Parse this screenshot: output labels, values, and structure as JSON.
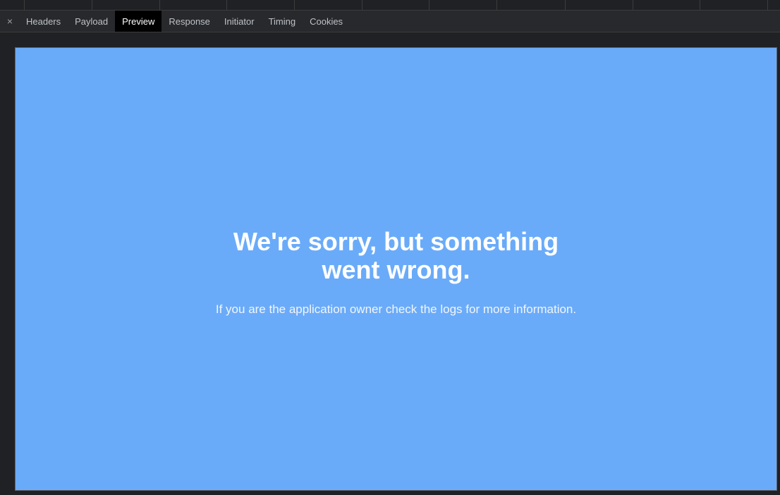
{
  "tabbar": {
    "close_icon": "close-icon",
    "close_glyph": "×",
    "tabs": [
      {
        "label": "Headers"
      },
      {
        "label": "Payload"
      },
      {
        "label": "Preview"
      },
      {
        "label": "Response"
      },
      {
        "label": "Initiator"
      },
      {
        "label": "Timing"
      },
      {
        "label": "Cookies"
      }
    ],
    "active_tab": "Preview"
  },
  "preview": {
    "heading": "We're sorry, but something went wrong.",
    "body": "If you are the application owner check the logs for more information."
  },
  "colors": {
    "devtools_bg": "#202124",
    "tabbar_bg": "#28292c",
    "active_tab_bg": "#000000",
    "preview_bg": "#6aabf9",
    "preview_text": "#ffffff"
  }
}
